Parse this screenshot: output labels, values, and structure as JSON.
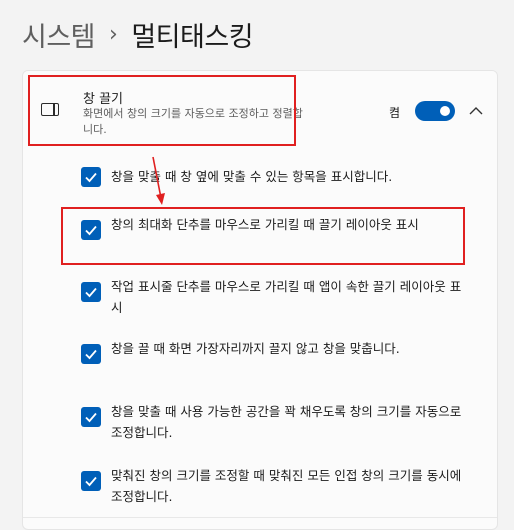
{
  "breadcrumb": {
    "parent": "시스템",
    "separator": "›",
    "current": "멀티태스킹"
  },
  "snap_section": {
    "icon": "snap-window-icon",
    "title": "창 끌기",
    "description": "화면에서 창의 크기를 자동으로 조정하고 정렬합니다.",
    "toggle_label": "켬",
    "toggle_on": true,
    "expanded": true
  },
  "options": [
    {
      "checked": true,
      "label": "창을 맞출 때 창 옆에 맞출 수 있는 항목을 표시합니다."
    },
    {
      "checked": true,
      "label": "창의 최대화 단추를 마우스로 가리킬 때 끌기 레이아웃 표시"
    },
    {
      "checked": true,
      "label": "작업 표시줄 단추를 마우스로 가리킬 때 앱이 속한 끌기 레이아웃 표시"
    },
    {
      "checked": true,
      "label": "창을 끌 때 화면 가장자리까지 끌지 않고 창을 맞춥니다."
    },
    {
      "checked": true,
      "label": "창을 맞출 때 사용 가능한 공간을 꽉 채우도록 창의 크기를 자동으로 조정합니다."
    },
    {
      "checked": true,
      "label": "맞춰진 창의 크기를 조정할 때 맞춰진 모든 인접 창의 크기를 동시에 조정합니다."
    }
  ],
  "colors": {
    "accent": "#005fb8",
    "annotation": "#e02020"
  }
}
